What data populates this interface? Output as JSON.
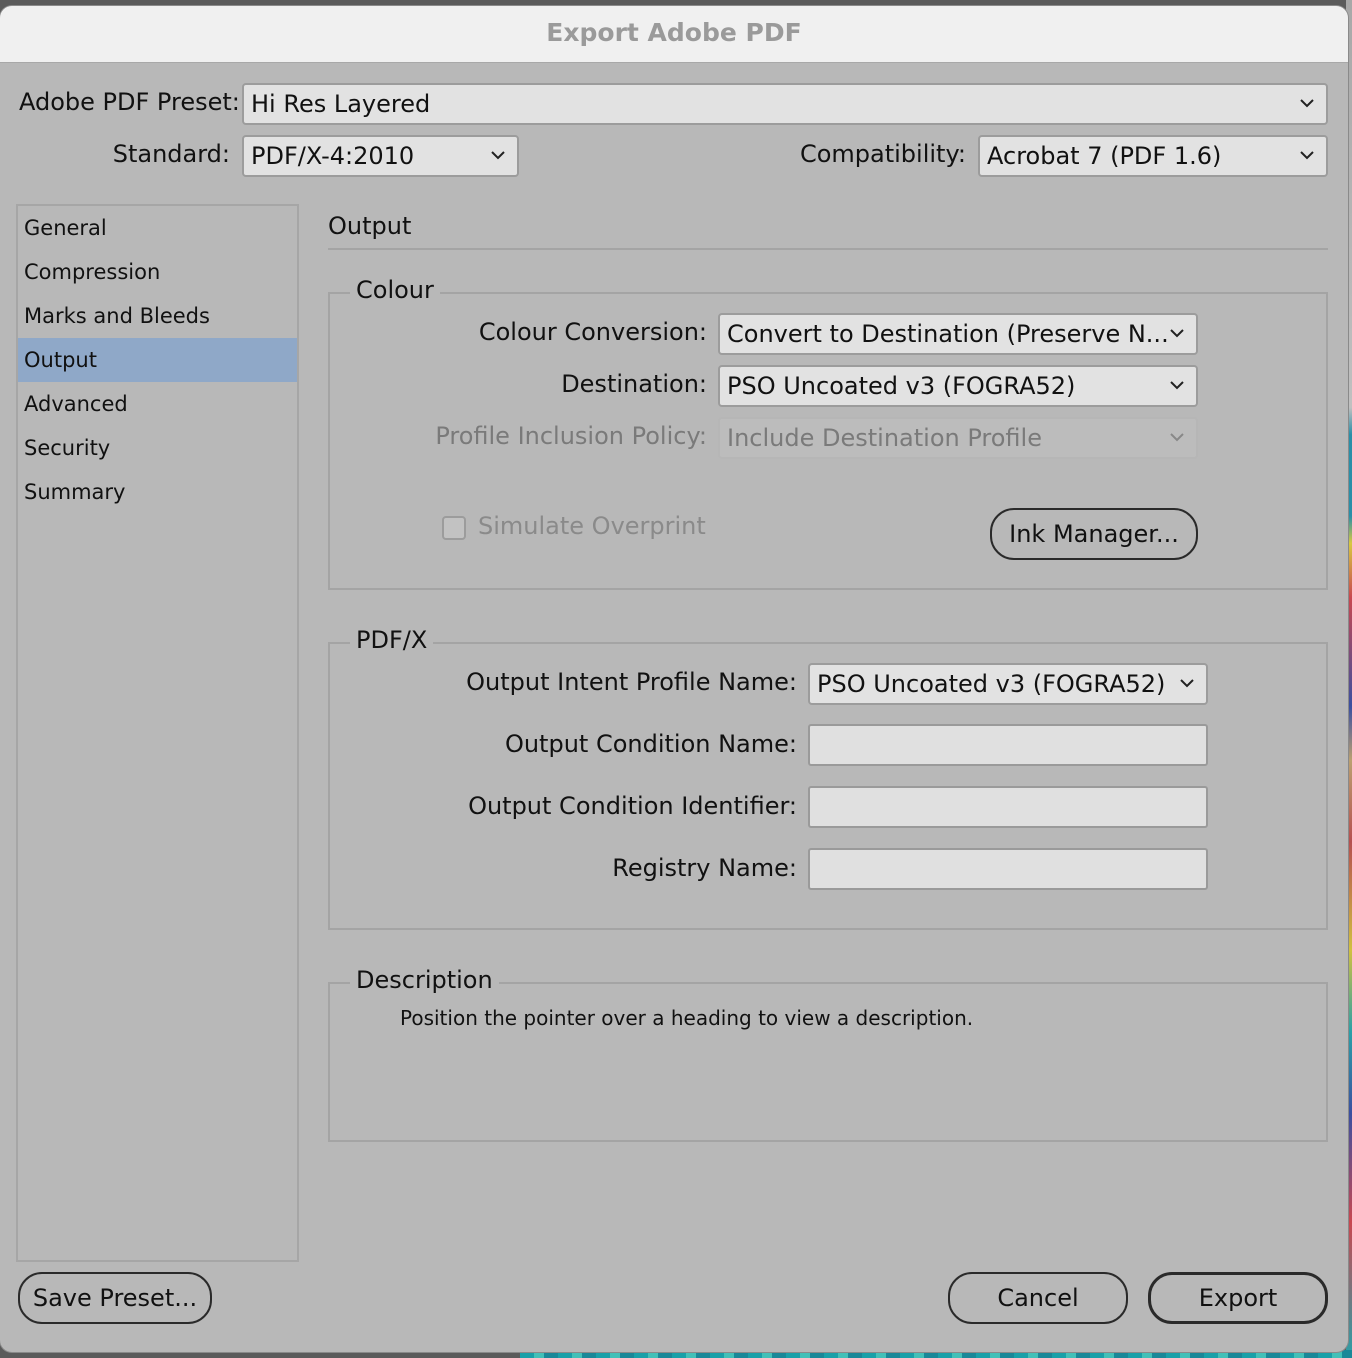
{
  "window": {
    "title": "Export Adobe PDF"
  },
  "header": {
    "preset_label": "Adobe PDF Preset:",
    "preset_value": "Hi Res Layered",
    "standard_label": "Standard:",
    "standard_value": "PDF/X-4:2010",
    "compat_label": "Compatibility:",
    "compat_value": "Acrobat 7 (PDF 1.6)"
  },
  "sidebar": {
    "items": [
      {
        "label": "General"
      },
      {
        "label": "Compression"
      },
      {
        "label": "Marks and Bleeds"
      },
      {
        "label": "Output",
        "selected": true
      },
      {
        "label": "Advanced"
      },
      {
        "label": "Security"
      },
      {
        "label": "Summary"
      }
    ]
  },
  "main": {
    "section_title": "Output",
    "colour": {
      "title": "Colour",
      "conversion_label": "Colour Conversion:",
      "conversion_value": "Convert to Destination (Preserve N...",
      "destination_label": "Destination:",
      "destination_value": "PSO Uncoated v3 (FOGRA52)",
      "policy_label": "Profile Inclusion Policy:",
      "policy_value": "Include Destination Profile",
      "simulate_label": "Simulate Overprint",
      "simulate_checked": false,
      "ink_manager_label": "Ink Manager..."
    },
    "pdfx": {
      "title": "PDF/X",
      "intent_label": "Output Intent Profile Name:",
      "intent_value": "PSO Uncoated v3 (FOGRA52)",
      "condition_name_label": "Output Condition Name:",
      "condition_name_value": "",
      "condition_id_label": "Output Condition Identifier:",
      "condition_id_value": "",
      "registry_label": "Registry Name:",
      "registry_value": ""
    },
    "description": {
      "title": "Description",
      "text": "Position the pointer over a heading to view a description."
    }
  },
  "footer": {
    "save_preset_label": "Save Preset...",
    "cancel_label": "Cancel",
    "export_label": "Export"
  },
  "colors": {
    "selected_item_bg": "#8fa8c8",
    "dialog_bg": "#b8b8b8",
    "titlebar_bg": "#f0f0f0"
  }
}
